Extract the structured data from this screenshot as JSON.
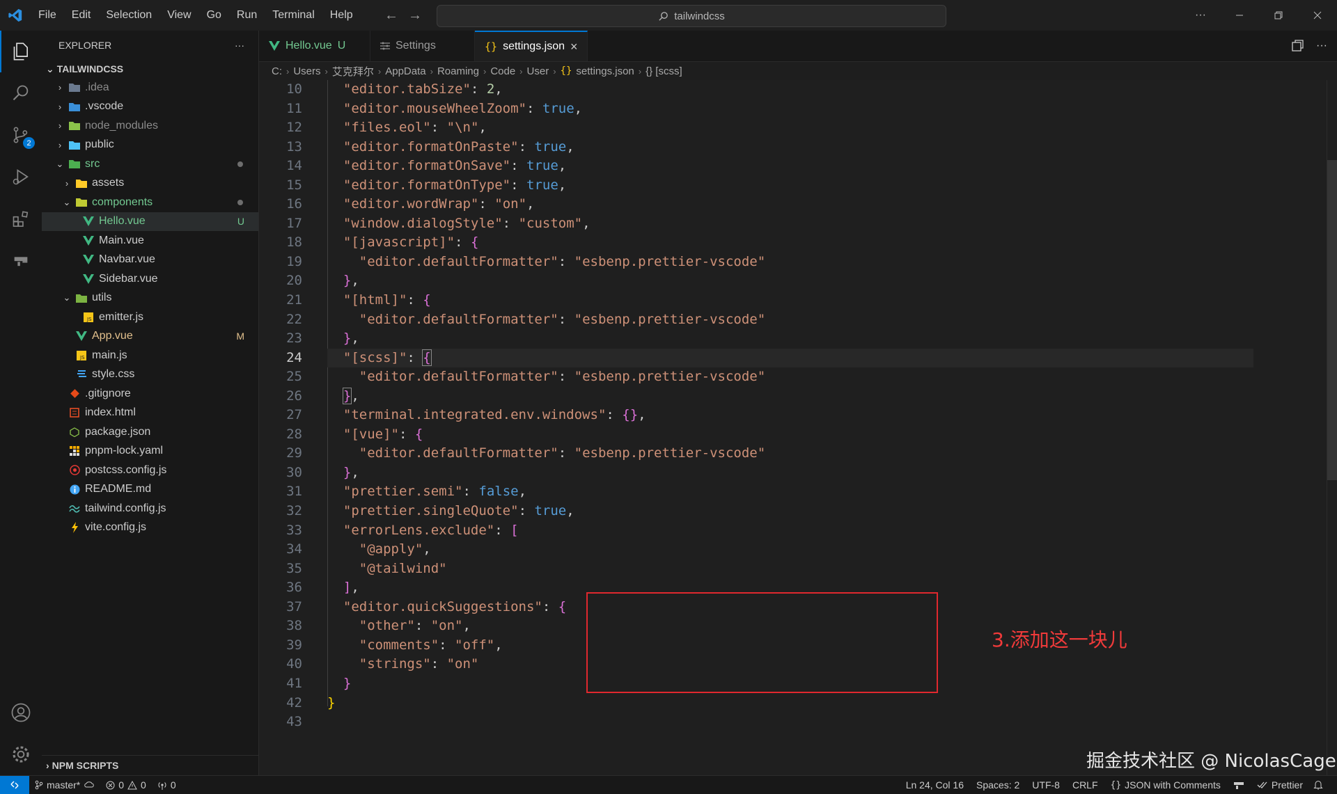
{
  "menu": [
    "File",
    "Edit",
    "Selection",
    "View",
    "Go",
    "Run",
    "Terminal",
    "Help"
  ],
  "search": {
    "label": "tailwindcss"
  },
  "explorer": {
    "title": "EXPLORER",
    "more": "···",
    "root": "TAILWINDCSS",
    "items": [
      {
        "name": ".idea",
        "status": ""
      },
      {
        "name": ".vscode",
        "status": ""
      },
      {
        "name": "node_modules",
        "status": ""
      },
      {
        "name": "public",
        "status": ""
      },
      {
        "name": "src",
        "status": ""
      },
      {
        "name": "assets",
        "status": ""
      },
      {
        "name": "components",
        "status": ""
      },
      {
        "name": "Hello.vue",
        "status": "U"
      },
      {
        "name": "Main.vue",
        "status": ""
      },
      {
        "name": "Navbar.vue",
        "status": ""
      },
      {
        "name": "Sidebar.vue",
        "status": ""
      },
      {
        "name": "utils",
        "status": ""
      },
      {
        "name": "emitter.js",
        "status": ""
      },
      {
        "name": "App.vue",
        "status": "M"
      },
      {
        "name": "main.js",
        "status": ""
      },
      {
        "name": "style.css",
        "status": ""
      },
      {
        "name": ".gitignore",
        "status": ""
      },
      {
        "name": "index.html",
        "status": ""
      },
      {
        "name": "package.json",
        "status": ""
      },
      {
        "name": "pnpm-lock.yaml",
        "status": ""
      },
      {
        "name": "postcss.config.js",
        "status": ""
      },
      {
        "name": "README.md",
        "status": ""
      },
      {
        "name": "tailwind.config.js",
        "status": ""
      },
      {
        "name": "vite.config.js",
        "status": ""
      }
    ],
    "npm_scripts": "NPM SCRIPTS"
  },
  "tabs": [
    {
      "label": "Hello.vue",
      "status": "U"
    },
    {
      "label": "Settings",
      "status": ""
    },
    {
      "label": "settings.json",
      "status": ""
    }
  ],
  "breadcrumb": [
    "C:",
    "Users",
    "艾克拜尔",
    "AppData",
    "Roaming",
    "Code",
    "User",
    "settings.json",
    "{} [scss]"
  ],
  "editor": {
    "line_numbers": [
      "10",
      "11",
      "12",
      "13",
      "14",
      "15",
      "16",
      "17",
      "18",
      "19",
      "20",
      "21",
      "22",
      "23",
      "24",
      "25",
      "26",
      "27",
      "28",
      "29",
      "30",
      "31",
      "32",
      "33",
      "34",
      "35",
      "36",
      "37",
      "38",
      "39",
      "40",
      "41",
      "42",
      "43"
    ],
    "current_line": "24",
    "annotation": "3.添加这一块儿"
  },
  "watermark": "掘金技术社区 @ NicolasCage",
  "status": {
    "branch": "master*",
    "errors": "0",
    "warnings": "0",
    "ports": "0",
    "position": "Ln 24, Col 16",
    "spaces": "Spaces: 2",
    "encoding": "UTF-8",
    "eol": "CRLF",
    "language": "JSON with Comments",
    "prettier": "Prettier"
  },
  "colors": {
    "accent": "#0078d4",
    "annotation": "#e0282e",
    "string": "#ce9178",
    "keyword": "#569cd6"
  }
}
